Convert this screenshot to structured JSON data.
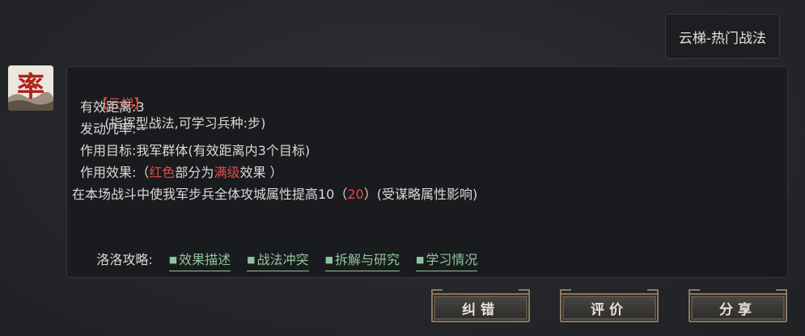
{
  "user_message": {
    "text": "云梯-热门战法"
  },
  "avatar": {
    "glyph": "率"
  },
  "skill": {
    "name": "【云梯】",
    "type_info": "(指挥型战法,可学习兵种:步)",
    "range": "有效距离:3",
    "trigger_rate": "发动几率:--",
    "target": "作用目标:我军群体(有效距离内3个目标)",
    "effect_prefix": "作用效果:（",
    "effect_red": "红色",
    "effect_mid": "部分为",
    "effect_max": "满级",
    "effect_suffix": "效果 ）",
    "desc_prefix": "在本场战斗中使我军步兵全体攻城属性提高10（",
    "desc_max_value": "20",
    "desc_suffix": "）(受谋略属性影响)"
  },
  "strategy": {
    "label": "洛洛攻略:",
    "links": [
      {
        "label": "效果描述",
        "marker": "■"
      },
      {
        "label": "战法冲突",
        "marker": "■"
      },
      {
        "label": "拆解与研究",
        "marker": "■"
      },
      {
        "label": "学习情况",
        "marker": "■"
      }
    ]
  },
  "actions": {
    "correct": "纠错",
    "review": "评价",
    "share": "分享"
  },
  "colors": {
    "highlight_red": "#e04a45",
    "link_green": "#8fc49a",
    "button_border": "#8a7a64"
  }
}
